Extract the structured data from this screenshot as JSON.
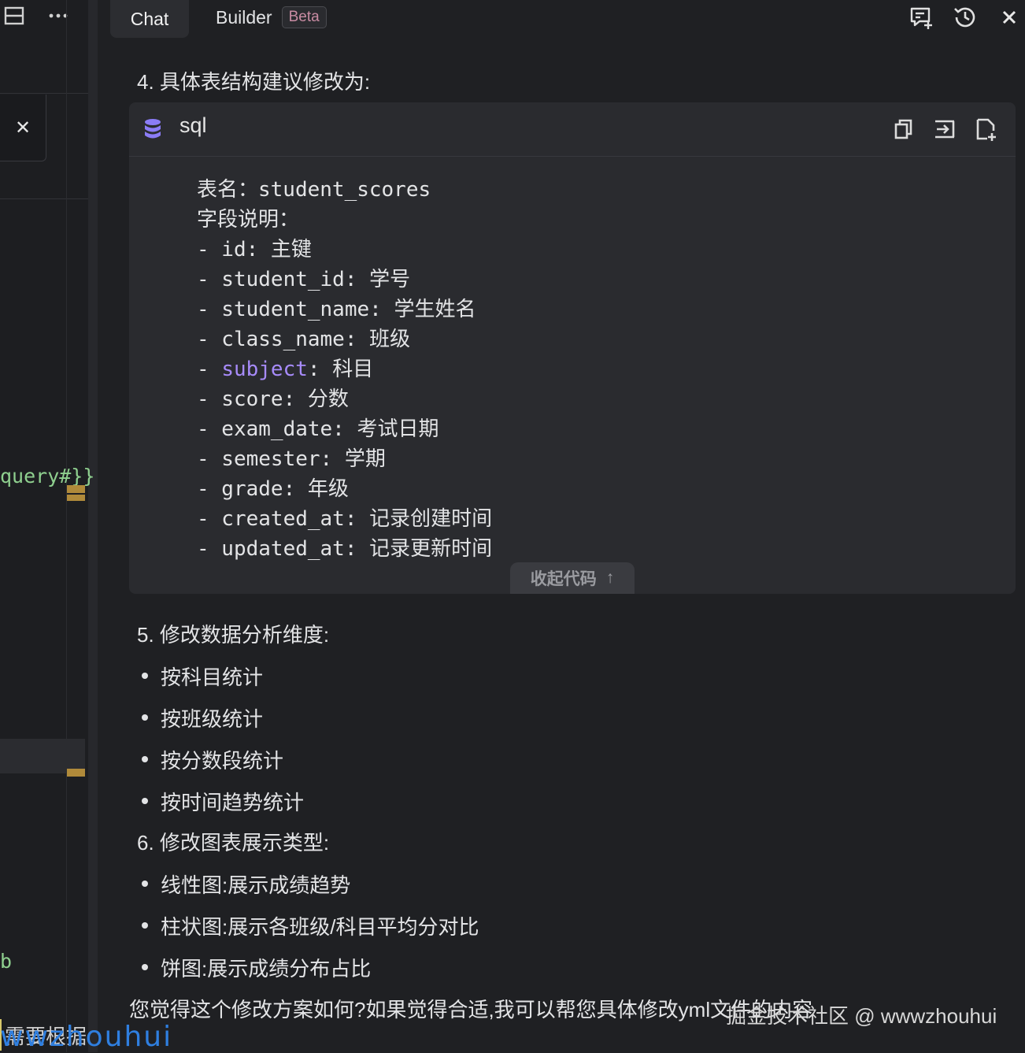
{
  "left_panel": {
    "code_fragment": "query#}}",
    "code_fragment_2": "b",
    "bottom_text": "需要根据",
    "bottom_watermark": "wwzhouhui"
  },
  "tabs": [
    {
      "label": "Chat",
      "active": true
    },
    {
      "label": "Builder",
      "badge": "Beta"
    }
  ],
  "top_right_icons": [
    "new-chat-icon",
    "history-icon",
    "close-icon"
  ],
  "section4_title": "4. 具体表结构建议修改为:",
  "code_block": {
    "language": "sql",
    "lines": [
      {
        "n": "1",
        "pre": "表名：student_scores",
        "kw": "",
        "post": ""
      },
      {
        "n": "2",
        "pre": "字段说明：",
        "kw": "",
        "post": ""
      },
      {
        "n": "3",
        "pre": "- id: 主键",
        "kw": "",
        "post": ""
      },
      {
        "n": "4",
        "pre": "- student_id: 学号",
        "kw": "",
        "post": ""
      },
      {
        "n": "5",
        "pre": "- student_name: 学生姓名",
        "kw": "",
        "post": ""
      },
      {
        "n": "6",
        "pre": "- class_name: 班级",
        "kw": "",
        "post": ""
      },
      {
        "n": "7",
        "pre": "- ",
        "kw": "subject",
        "post": ": 科目"
      },
      {
        "n": "8",
        "pre": "- score: 分数",
        "kw": "",
        "post": ""
      },
      {
        "n": "9",
        "pre": "- exam_date: 考试日期",
        "kw": "",
        "post": ""
      },
      {
        "n": "10",
        "pre": "- semester: 学期",
        "kw": "",
        "post": ""
      },
      {
        "n": "11",
        "pre": "- grade: 年级",
        "kw": "",
        "post": ""
      },
      {
        "n": "12",
        "pre": "- created_at: 记录创建时间",
        "kw": "",
        "post": ""
      },
      {
        "n": "13",
        "pre": "- updated_at: 记录更新时间",
        "kw": "",
        "post": ""
      }
    ],
    "collapse_label": "收起代码",
    "collapse_arrow": "↑"
  },
  "section5_title": "5. 修改数据分析维度:",
  "section5_items": [
    "按科目统计",
    "按班级统计",
    "按分数段统计",
    "按时间趋势统计"
  ],
  "section6_title": "6. 修改图表展示类型:",
  "section6_items": [
    "线性图:展示成绩趋势",
    "柱状图:展示各班级/科目平均分对比",
    "饼图:展示成绩分布占比"
  ],
  "closing_text": "您觉得这个修改方案如何?如果觉得合适,我可以帮您具体修改yml文件的内容",
  "watermark": "掘金技术社区 @ wwwzhouhui",
  "colors": {
    "background": "#1f2023",
    "code_bg": "#2a2b2f",
    "keyword": "#a78bfa",
    "sql_icon": "#8b7cf6",
    "beta_text": "#c98ca3"
  }
}
